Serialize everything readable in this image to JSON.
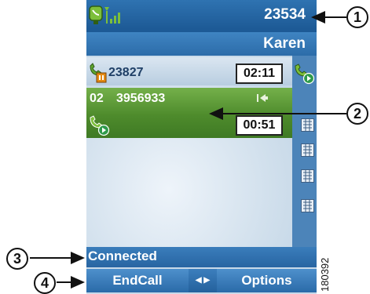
{
  "status_bar": {
    "extension": "23534"
  },
  "user_bar": {
    "name": "Karen"
  },
  "calls": {
    "held": {
      "number": "23827",
      "timer": "02:11"
    },
    "active": {
      "line": "02",
      "number": "3956933",
      "timer": "00:51"
    }
  },
  "prompt": {
    "status_text": "Connected"
  },
  "softkeys": {
    "left_label": "EndCall",
    "right_label": "Options"
  },
  "callouts": [
    "1",
    "2",
    "3",
    "4"
  ],
  "figure_number": "180392",
  "colors": {
    "active_call": "#4e8b2c",
    "bar_blue": "#2a6aa8",
    "screen_bg": "#c9d9e9"
  }
}
